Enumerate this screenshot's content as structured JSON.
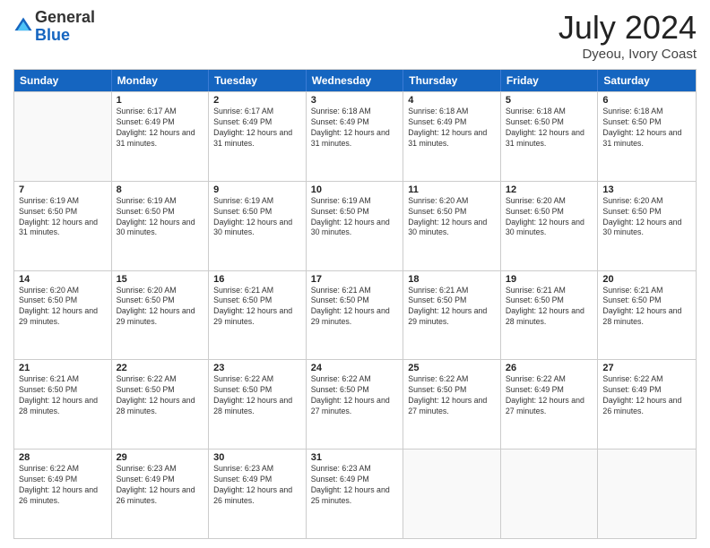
{
  "header": {
    "logo_general": "General",
    "logo_blue": "Blue",
    "month": "July 2024",
    "location": "Dyeou, Ivory Coast"
  },
  "calendar": {
    "weekdays": [
      "Sunday",
      "Monday",
      "Tuesday",
      "Wednesday",
      "Thursday",
      "Friday",
      "Saturday"
    ],
    "rows": [
      [
        {
          "day": "",
          "sunrise": "",
          "sunset": "",
          "daylight": "",
          "empty": true
        },
        {
          "day": "1",
          "sunrise": "Sunrise: 6:17 AM",
          "sunset": "Sunset: 6:49 PM",
          "daylight": "Daylight: 12 hours and 31 minutes."
        },
        {
          "day": "2",
          "sunrise": "Sunrise: 6:17 AM",
          "sunset": "Sunset: 6:49 PM",
          "daylight": "Daylight: 12 hours and 31 minutes."
        },
        {
          "day": "3",
          "sunrise": "Sunrise: 6:18 AM",
          "sunset": "Sunset: 6:49 PM",
          "daylight": "Daylight: 12 hours and 31 minutes."
        },
        {
          "day": "4",
          "sunrise": "Sunrise: 6:18 AM",
          "sunset": "Sunset: 6:49 PM",
          "daylight": "Daylight: 12 hours and 31 minutes."
        },
        {
          "day": "5",
          "sunrise": "Sunrise: 6:18 AM",
          "sunset": "Sunset: 6:50 PM",
          "daylight": "Daylight: 12 hours and 31 minutes."
        },
        {
          "day": "6",
          "sunrise": "Sunrise: 6:18 AM",
          "sunset": "Sunset: 6:50 PM",
          "daylight": "Daylight: 12 hours and 31 minutes."
        }
      ],
      [
        {
          "day": "7",
          "sunrise": "Sunrise: 6:19 AM",
          "sunset": "Sunset: 6:50 PM",
          "daylight": "Daylight: 12 hours and 31 minutes."
        },
        {
          "day": "8",
          "sunrise": "Sunrise: 6:19 AM",
          "sunset": "Sunset: 6:50 PM",
          "daylight": "Daylight: 12 hours and 30 minutes."
        },
        {
          "day": "9",
          "sunrise": "Sunrise: 6:19 AM",
          "sunset": "Sunset: 6:50 PM",
          "daylight": "Daylight: 12 hours and 30 minutes."
        },
        {
          "day": "10",
          "sunrise": "Sunrise: 6:19 AM",
          "sunset": "Sunset: 6:50 PM",
          "daylight": "Daylight: 12 hours and 30 minutes."
        },
        {
          "day": "11",
          "sunrise": "Sunrise: 6:20 AM",
          "sunset": "Sunset: 6:50 PM",
          "daylight": "Daylight: 12 hours and 30 minutes."
        },
        {
          "day": "12",
          "sunrise": "Sunrise: 6:20 AM",
          "sunset": "Sunset: 6:50 PM",
          "daylight": "Daylight: 12 hours and 30 minutes."
        },
        {
          "day": "13",
          "sunrise": "Sunrise: 6:20 AM",
          "sunset": "Sunset: 6:50 PM",
          "daylight": "Daylight: 12 hours and 30 minutes."
        }
      ],
      [
        {
          "day": "14",
          "sunrise": "Sunrise: 6:20 AM",
          "sunset": "Sunset: 6:50 PM",
          "daylight": "Daylight: 12 hours and 29 minutes."
        },
        {
          "day": "15",
          "sunrise": "Sunrise: 6:20 AM",
          "sunset": "Sunset: 6:50 PM",
          "daylight": "Daylight: 12 hours and 29 minutes."
        },
        {
          "day": "16",
          "sunrise": "Sunrise: 6:21 AM",
          "sunset": "Sunset: 6:50 PM",
          "daylight": "Daylight: 12 hours and 29 minutes."
        },
        {
          "day": "17",
          "sunrise": "Sunrise: 6:21 AM",
          "sunset": "Sunset: 6:50 PM",
          "daylight": "Daylight: 12 hours and 29 minutes."
        },
        {
          "day": "18",
          "sunrise": "Sunrise: 6:21 AM",
          "sunset": "Sunset: 6:50 PM",
          "daylight": "Daylight: 12 hours and 29 minutes."
        },
        {
          "day": "19",
          "sunrise": "Sunrise: 6:21 AM",
          "sunset": "Sunset: 6:50 PM",
          "daylight": "Daylight: 12 hours and 28 minutes."
        },
        {
          "day": "20",
          "sunrise": "Sunrise: 6:21 AM",
          "sunset": "Sunset: 6:50 PM",
          "daylight": "Daylight: 12 hours and 28 minutes."
        }
      ],
      [
        {
          "day": "21",
          "sunrise": "Sunrise: 6:21 AM",
          "sunset": "Sunset: 6:50 PM",
          "daylight": "Daylight: 12 hours and 28 minutes."
        },
        {
          "day": "22",
          "sunrise": "Sunrise: 6:22 AM",
          "sunset": "Sunset: 6:50 PM",
          "daylight": "Daylight: 12 hours and 28 minutes."
        },
        {
          "day": "23",
          "sunrise": "Sunrise: 6:22 AM",
          "sunset": "Sunset: 6:50 PM",
          "daylight": "Daylight: 12 hours and 28 minutes."
        },
        {
          "day": "24",
          "sunrise": "Sunrise: 6:22 AM",
          "sunset": "Sunset: 6:50 PM",
          "daylight": "Daylight: 12 hours and 27 minutes."
        },
        {
          "day": "25",
          "sunrise": "Sunrise: 6:22 AM",
          "sunset": "Sunset: 6:50 PM",
          "daylight": "Daylight: 12 hours and 27 minutes."
        },
        {
          "day": "26",
          "sunrise": "Sunrise: 6:22 AM",
          "sunset": "Sunset: 6:49 PM",
          "daylight": "Daylight: 12 hours and 27 minutes."
        },
        {
          "day": "27",
          "sunrise": "Sunrise: 6:22 AM",
          "sunset": "Sunset: 6:49 PM",
          "daylight": "Daylight: 12 hours and 26 minutes."
        }
      ],
      [
        {
          "day": "28",
          "sunrise": "Sunrise: 6:22 AM",
          "sunset": "Sunset: 6:49 PM",
          "daylight": "Daylight: 12 hours and 26 minutes."
        },
        {
          "day": "29",
          "sunrise": "Sunrise: 6:23 AM",
          "sunset": "Sunset: 6:49 PM",
          "daylight": "Daylight: 12 hours and 26 minutes."
        },
        {
          "day": "30",
          "sunrise": "Sunrise: 6:23 AM",
          "sunset": "Sunset: 6:49 PM",
          "daylight": "Daylight: 12 hours and 26 minutes."
        },
        {
          "day": "31",
          "sunrise": "Sunrise: 6:23 AM",
          "sunset": "Sunset: 6:49 PM",
          "daylight": "Daylight: 12 hours and 25 minutes."
        },
        {
          "day": "",
          "sunrise": "",
          "sunset": "",
          "daylight": "",
          "empty": true
        },
        {
          "day": "",
          "sunrise": "",
          "sunset": "",
          "daylight": "",
          "empty": true
        },
        {
          "day": "",
          "sunrise": "",
          "sunset": "",
          "daylight": "",
          "empty": true
        }
      ]
    ]
  }
}
